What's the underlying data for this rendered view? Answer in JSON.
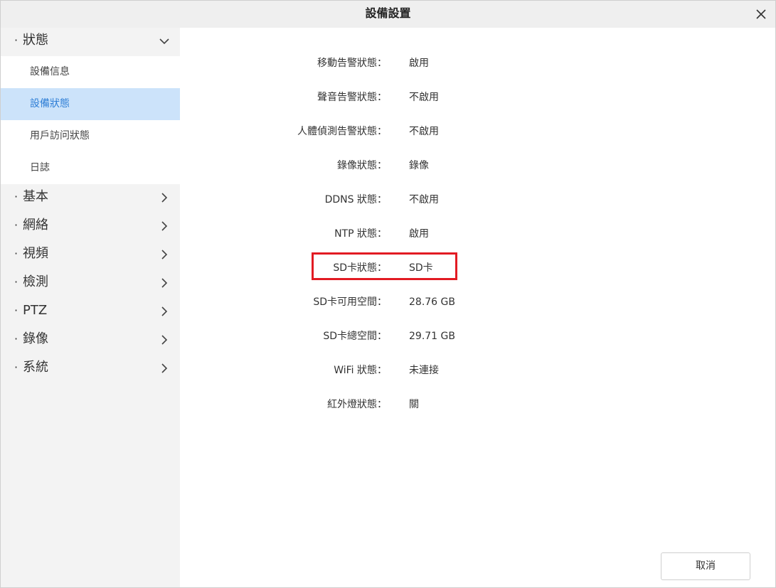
{
  "window": {
    "title": "設備設置"
  },
  "sidebar": {
    "expanded_group": {
      "label": "狀態",
      "items": [
        {
          "label": "設備信息"
        },
        {
          "label": "設備狀態"
        },
        {
          "label": "用戶訪问狀態"
        },
        {
          "label": "日誌"
        }
      ]
    },
    "groups": [
      {
        "label": "基本"
      },
      {
        "label": "網絡"
      },
      {
        "label": "視頻"
      },
      {
        "label": "檢測"
      },
      {
        "label": "PTZ"
      },
      {
        "label": "錄像"
      },
      {
        "label": "系統"
      }
    ],
    "bullet": "·",
    "active_item": "設備狀態"
  },
  "status": {
    "rows": [
      {
        "key": "移動告警狀態：",
        "value": "啟用"
      },
      {
        "key": "聲音告警狀態：",
        "value": "不啟用"
      },
      {
        "key": "人體偵測告警狀態：",
        "value": "不啟用"
      },
      {
        "key": "錄像狀態：",
        "value": "錄像"
      },
      {
        "key": "DDNS 狀態：",
        "value": "不啟用"
      },
      {
        "key": "NTP 狀態：",
        "value": "啟用"
      },
      {
        "key": "SD卡狀態：",
        "value": "SD卡"
      },
      {
        "key": "SD卡可用空間：",
        "value": "28.76 GB"
      },
      {
        "key": "SD卡總空間：",
        "value": "29.71 GB"
      },
      {
        "key": "WiFi 狀態：",
        "value": "未連接"
      },
      {
        "key": "紅外燈狀態：",
        "value": "關"
      }
    ]
  },
  "footer": {
    "cancel_label": "取消"
  },
  "colors": {
    "accent": "#2f7fd6",
    "active_bg": "#cce3fa",
    "highlight": "#e21b23",
    "sidebar_bg": "#f3f3f3",
    "titlebar_bg": "#efefef"
  }
}
